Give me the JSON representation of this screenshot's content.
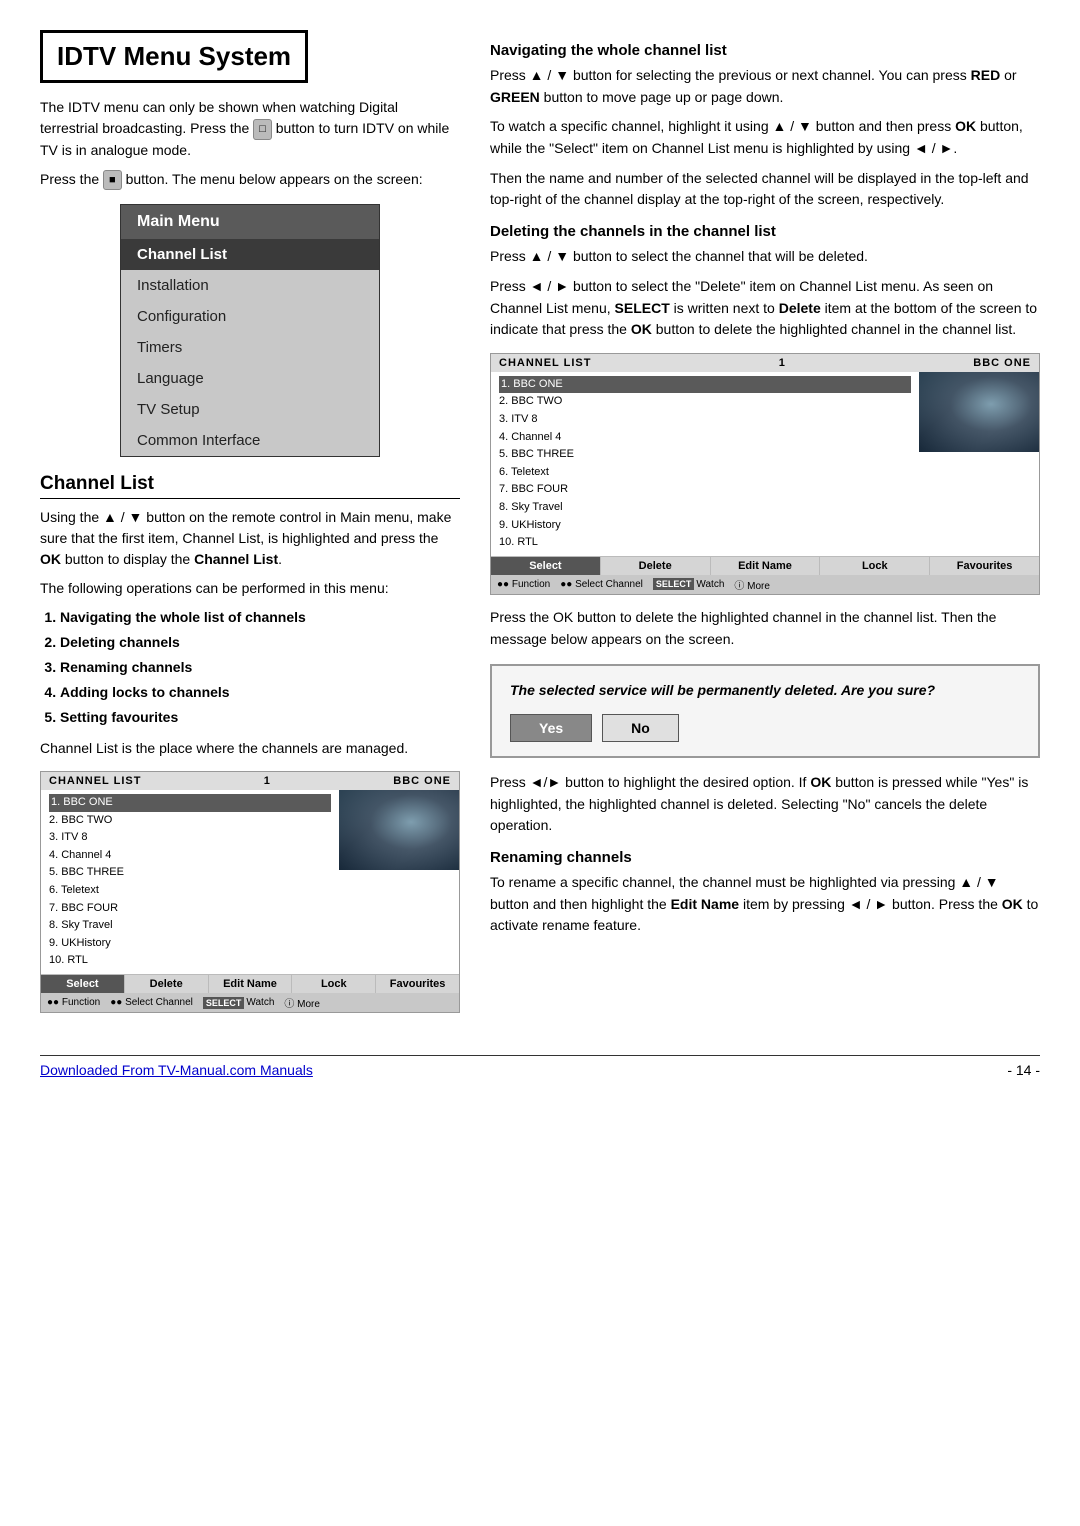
{
  "page": {
    "title": "IDTV Menu System",
    "footer_link": "Downloaded From TV-Manual.com Manuals",
    "page_number": "- 14 -"
  },
  "left": {
    "intro": [
      "The IDTV menu can only be shown when watching Digital terrestrial broadcasting. Press the",
      "button to turn IDTV on while TV is in analogue mode.",
      "Press the button. The menu below appears on the screen:"
    ],
    "menu": {
      "title": "Main Menu",
      "items": [
        {
          "label": "Channel List",
          "active": true
        },
        {
          "label": "Installation",
          "active": false
        },
        {
          "label": "Configuration",
          "active": false
        },
        {
          "label": "Timers",
          "active": false
        },
        {
          "label": "Language",
          "active": false
        },
        {
          "label": "TV Setup",
          "active": false
        },
        {
          "label": "Common Interface",
          "active": false
        }
      ]
    },
    "channel_list_section": {
      "title": "Channel List",
      "body1": "Using the ▲ / ▼ button on the remote control in Main menu, make sure that the first item, Channel List, is highlighted and press the OK button to display the Channel List.",
      "body2": "The following operations can be performed in this menu:",
      "operations": [
        "Navigating the whole list of channels",
        "Deleting channels",
        "Renaming channels",
        "Adding locks to channels",
        "Setting favourites"
      ],
      "body3": "Channel List is the place where the channels are managed."
    },
    "channel_box_1": {
      "header_left": "CHANNEL LIST",
      "header_center": "1",
      "header_right": "BBC ONE",
      "channels": [
        "1. BBC ONE",
        "2. BBC TWO",
        "3. ITV 8",
        "4. Channel 4",
        "5. BBC THREE",
        "6. Teletext",
        "7. BBC FOUR",
        "8. Sky Travel",
        "9. UKHistory",
        "10. RTL"
      ],
      "buttons": [
        "Select",
        "Delete",
        "Edit Name",
        "Lock",
        "Favourites"
      ],
      "active_button": "Select",
      "footer_items": [
        "○● Function",
        "○● Select Channel",
        "SELECT Watch",
        "ℹ More"
      ]
    }
  },
  "right": {
    "nav_title": "Navigating the whole channel list",
    "nav_body1": "Press ▲ / ▼ button for selecting the previous or next channel. You can press RED or GREEN button to move page up or page down.",
    "nav_body2": "To watch a specific channel, highlight it using ▲ / ▼ button and then press OK button, while the \"Select\" item on Channel List menu is highlighted by using ◄ / ►.",
    "nav_body3": "Then the name and number of the selected channel will be displayed in the top-left and top-right of the channel display at the top-right of the screen, respectively.",
    "delete_title": "Deleting the channels in the channel list",
    "delete_body1": "Press ▲ / ▼ button to select the channel that will be deleted.",
    "delete_body2": "Press ◄ / ► button to select the \"Delete\" item on Channel List menu. As seen on Channel List menu, SELECT is written next to Delete item at the bottom of the screen to indicate that press the OK button to delete the highlighted channel in the channel list.",
    "channel_box_2": {
      "header_left": "CHANNEL LIST",
      "header_center": "1",
      "header_right": "BBC ONE",
      "channels": [
        "1. BBC ONE",
        "2. BBC TWO",
        "3. ITV 8",
        "4. Channel 4",
        "5. BBC THREE",
        "6. Teletext",
        "7. BBC FOUR",
        "8. Sky Travel",
        "9. UKHistory",
        "10. RTL"
      ],
      "buttons": [
        "Select",
        "Delete",
        "Edit Name",
        "Lock",
        "Favourites"
      ],
      "active_button": "Select",
      "footer_items": [
        "○● Function",
        "○● Select Channel",
        "SELECT Watch",
        "ℹ More"
      ]
    },
    "delete_body3": "Press the OK button to delete the highlighted channel in the channel list. Then the message below appears on the screen.",
    "confirm_box": {
      "text": "The selected service will be permanently deleted. Are you sure?",
      "yes": "Yes",
      "no": "No"
    },
    "delete_body4": "Press ◄/► button to highlight the desired option. If OK button is pressed while \"Yes\" is highlighted, the highlighted channel is deleted. Selecting \"No\" cancels the delete operation.",
    "rename_title": "Renaming channels",
    "rename_body": "To rename a specific channel, the channel must be highlighted via pressing ▲ / ▼ button and then highlight the Edit Name item by pressing ◄ / ► button. Press the OK to activate rename feature."
  }
}
